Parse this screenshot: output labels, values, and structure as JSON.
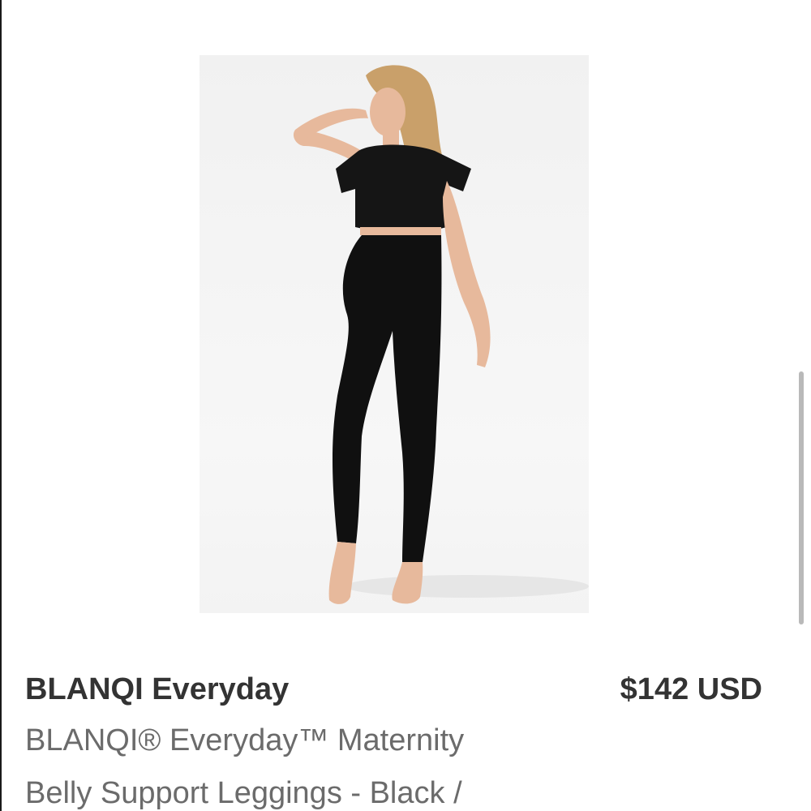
{
  "product": {
    "image_alt": "Model wearing black maternity belly support leggings and black cropped tee",
    "brand": "BLANQI Everyday",
    "price": "$142 USD",
    "title_lines": [
      "BLANQI® Everyday™ Maternity",
      "Belly Support Leggings - Black /"
    ]
  },
  "colors": {
    "text_primary": "#333333",
    "text_secondary": "#6b6b6b",
    "scrollbar": "#b9b9b9"
  }
}
